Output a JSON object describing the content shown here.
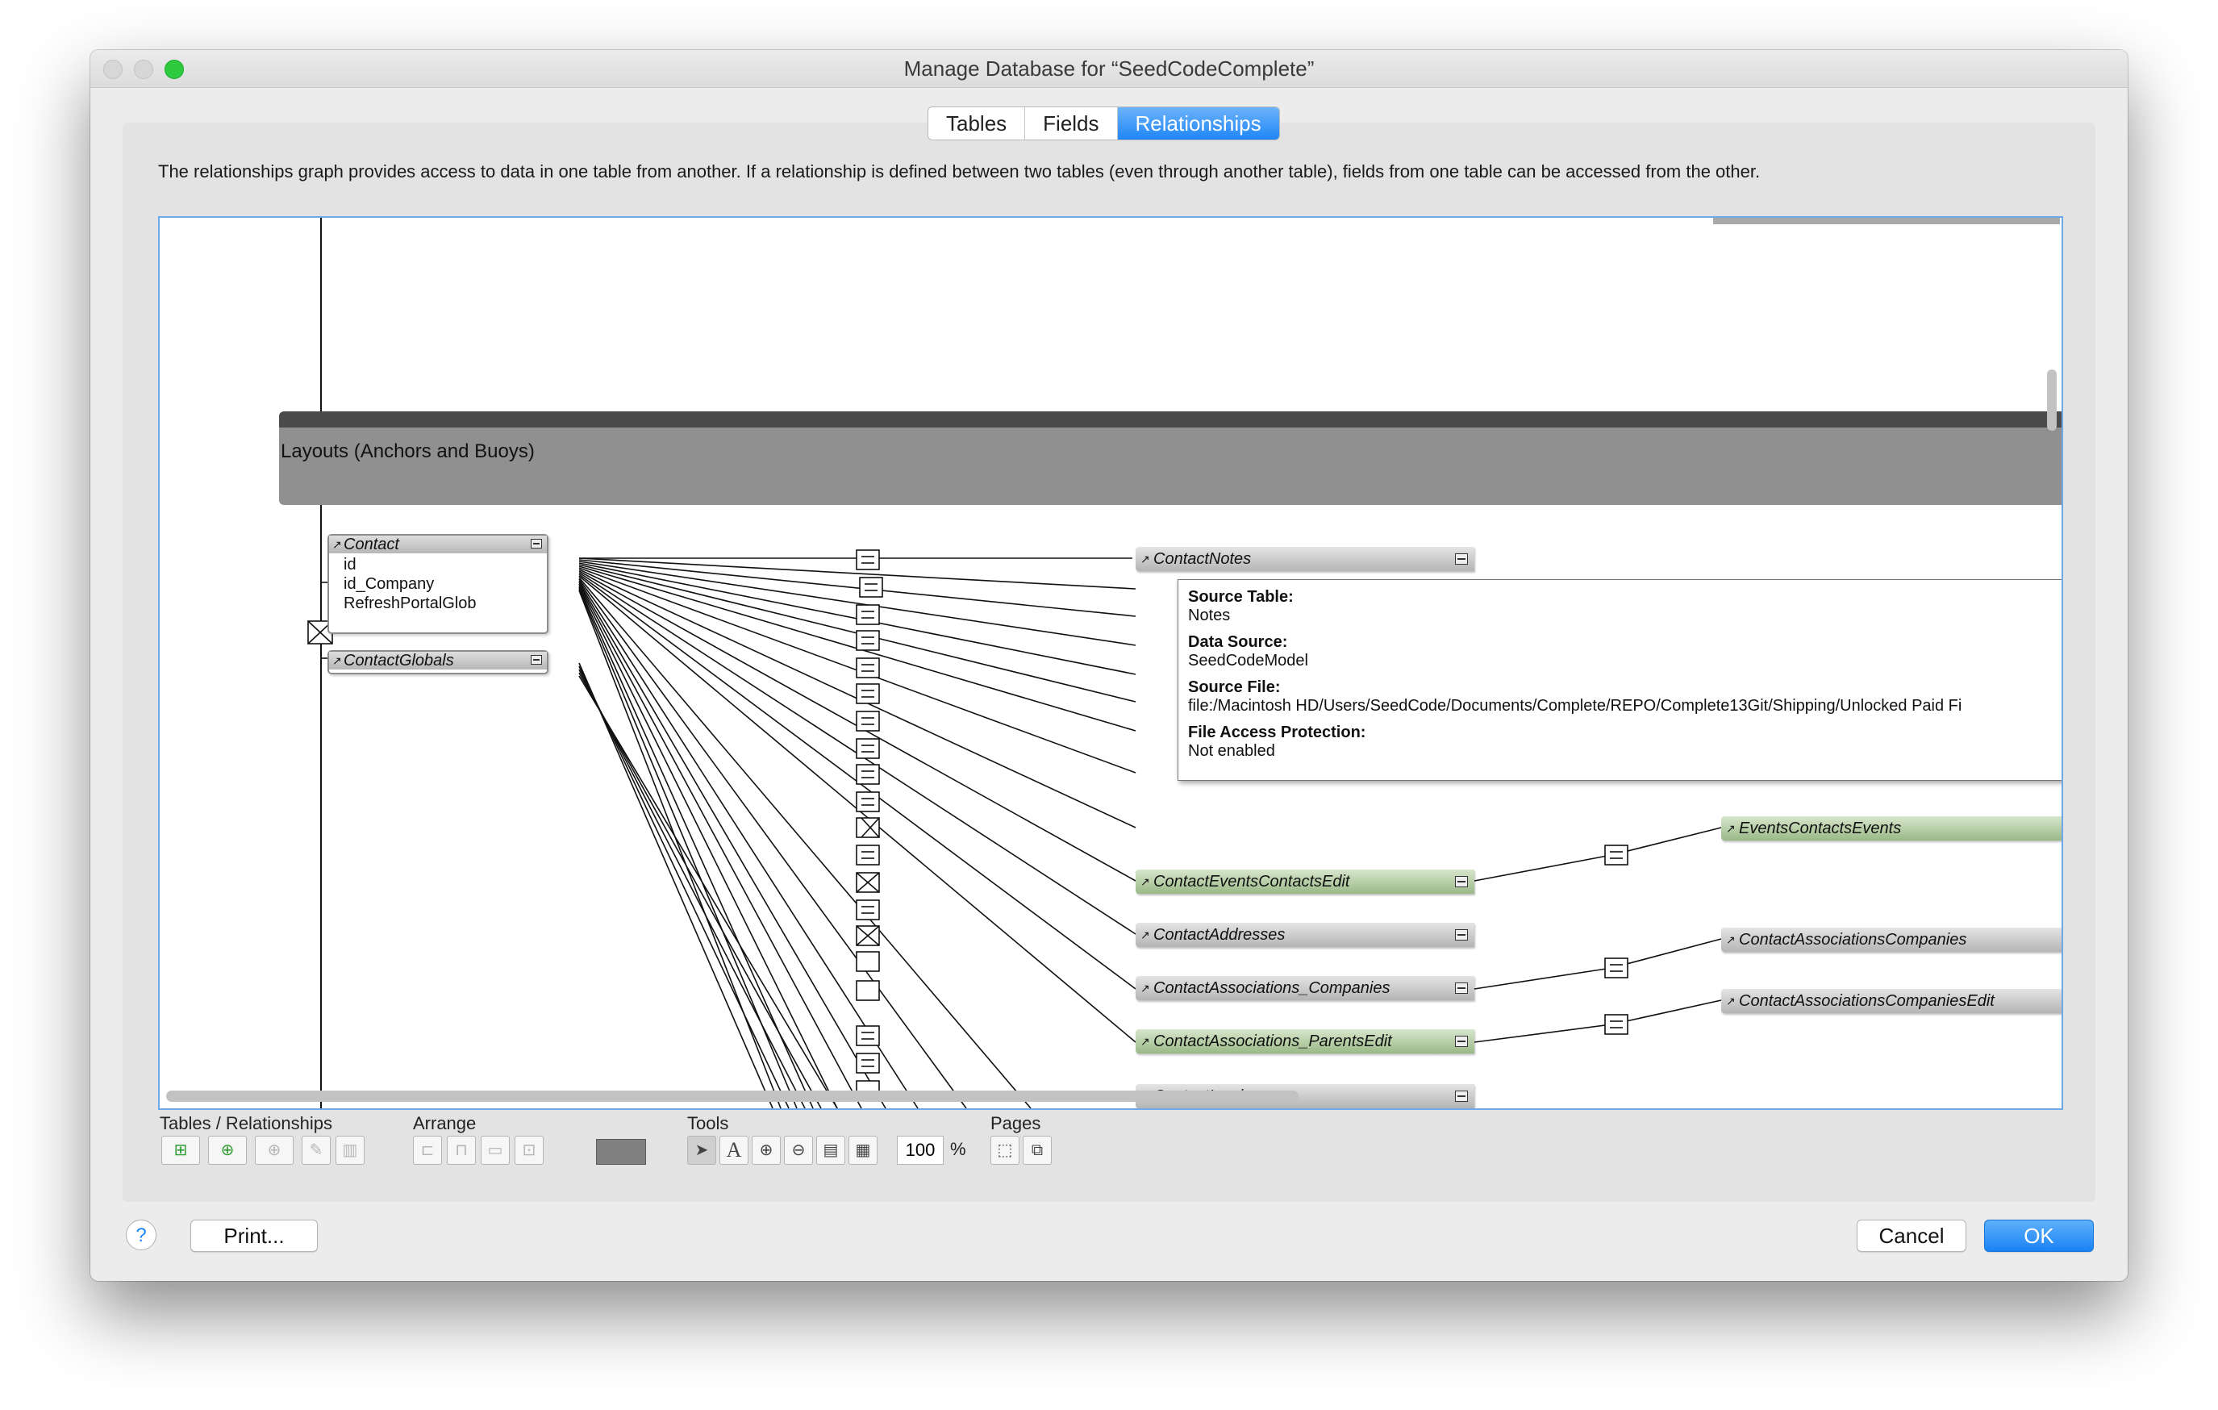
{
  "window": {
    "title": "Manage Database for “SeedCodeComplete”"
  },
  "tabs": [
    {
      "label": "Tables",
      "active": false
    },
    {
      "label": "Fields",
      "active": false
    },
    {
      "label": "Relationships",
      "active": true
    }
  ],
  "description": "The relationships graph provides access to data in one table from another. If a relationship is defined between two tables (even through another table), fields from one table can be accessed from the other.",
  "graph": {
    "group_label": "Layouts (Anchors and Buoys)",
    "contact_table": {
      "name": "Contact",
      "fields": [
        "id",
        "id_Company",
        "RefreshPortalGlob"
      ]
    },
    "globals_table": {
      "name": "ContactGlobals"
    },
    "related": [
      {
        "name": "ContactNotes",
        "green": false
      },
      {
        "name": "ContactEventsContactsEdit",
        "green": true
      },
      {
        "name": "ContactAddresses",
        "green": false
      },
      {
        "name": "ContactAssociations_Companies",
        "green": false
      },
      {
        "name": "ContactAssociations_ParentsEdit",
        "green": true
      },
      {
        "name": "ContactInvoices",
        "green": false
      }
    ],
    "far": [
      {
        "name": "EventsContactsEvents",
        "green": true
      },
      {
        "name": "ContactAssociationsCompanies",
        "green": false
      },
      {
        "name": "ContactAssociationsCompaniesEdit",
        "green": false
      }
    ],
    "tooltip": {
      "source_table_label": "Source Table:",
      "source_table": "Notes",
      "data_source_label": "Data Source:",
      "data_source": "SeedCodeModel",
      "source_file_label": "Source File:",
      "source_file": "file:/Macintosh HD/Users/SeedCode/Documents/Complete/REPO/Complete13Git/Shipping/Unlocked Paid Fi",
      "protection_label": "File Access Protection:",
      "protection": "Not enabled"
    }
  },
  "toolbar": {
    "tables_label": "Tables / Relationships",
    "arrange_label": "Arrange",
    "tools_label": "Tools",
    "pages_label": "Pages",
    "zoom_value": "100",
    "zoom_unit": "%"
  },
  "footer": {
    "help": "?",
    "print": "Print...",
    "cancel": "Cancel",
    "ok": "OK"
  },
  "colors": {
    "accent": "#1f86f5",
    "table_green": "#9ab987",
    "group_header": "#909090"
  }
}
